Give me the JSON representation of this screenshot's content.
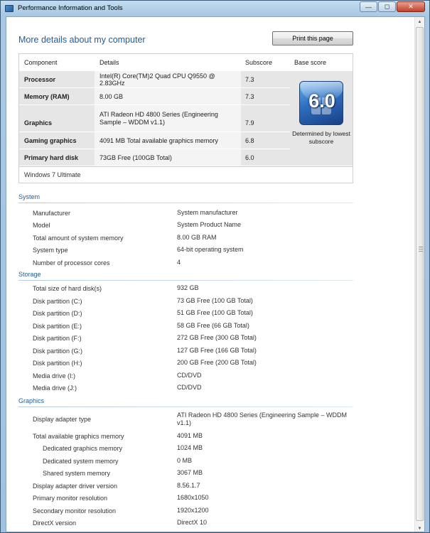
{
  "window": {
    "title": "Performance Information and Tools",
    "controls": {
      "minimize": "—",
      "maximize": "◻",
      "close": "✕"
    }
  },
  "page": {
    "title": "More details about my computer",
    "print_label": "Print this page"
  },
  "scores": {
    "headers": {
      "component": "Component",
      "details": "Details",
      "subscore": "Subscore",
      "base": "Base score"
    },
    "rows": [
      {
        "component": "Processor",
        "details": "Intel(R) Core(TM)2 Quad CPU Q9550 @ 2.83GHz",
        "subscore": "7.3"
      },
      {
        "component": "Memory (RAM)",
        "details": "8.00 GB",
        "subscore": "7.3"
      },
      {
        "component": "Graphics",
        "details": "ATI Radeon HD 4800 Series (Engineering Sample – WDDM v1.1)",
        "subscore": "7.9"
      },
      {
        "component": "Gaming graphics",
        "details": "4091 MB Total available graphics memory",
        "subscore": "6.8"
      },
      {
        "component": "Primary hard disk",
        "details": "73GB Free (100GB Total)",
        "subscore": "6.0"
      }
    ],
    "base_score": "6.0",
    "base_note": "Determined by lowest subscore",
    "edition": "Windows 7 Ultimate"
  },
  "system": {
    "heading": "System",
    "items": [
      {
        "label": "Manufacturer",
        "value": "System manufacturer"
      },
      {
        "label": "Model",
        "value": "System Product Name"
      },
      {
        "label": "Total amount of system memory",
        "value": "8.00 GB RAM"
      },
      {
        "label": "System type",
        "value": "64-bit operating system"
      },
      {
        "label": "Number of processor cores",
        "value": "4"
      }
    ]
  },
  "storage": {
    "heading": "Storage",
    "items": [
      {
        "label": "Total size of hard disk(s)",
        "value": "932 GB"
      },
      {
        "label": "Disk partition (C:)",
        "value": "73 GB Free (100 GB Total)"
      },
      {
        "label": "Disk partition (D:)",
        "value": "51 GB Free (100 GB Total)"
      },
      {
        "label": "Disk partition (E:)",
        "value": "58 GB Free (66 GB Total)"
      },
      {
        "label": "Disk partition (F:)",
        "value": "272 GB Free (300 GB Total)"
      },
      {
        "label": "Disk partition (G:)",
        "value": "127 GB Free (166 GB Total)"
      },
      {
        "label": "Disk partition (H:)",
        "value": "200 GB Free (200 GB Total)"
      },
      {
        "label": "Media drive (I:)",
        "value": "CD/DVD"
      },
      {
        "label": "Media drive (J:)",
        "value": "CD/DVD"
      }
    ]
  },
  "graphics": {
    "heading": "Graphics",
    "items": [
      {
        "label": "Display adapter type",
        "value": "ATI Radeon HD 4800 Series (Engineering Sample – WDDM v1.1)"
      },
      {
        "label": "Total available graphics memory",
        "value": "4091 MB"
      },
      {
        "label": "Dedicated graphics memory",
        "value": "1024 MB"
      },
      {
        "label": "Dedicated system memory",
        "value": "0 MB"
      },
      {
        "label": "Shared system memory",
        "value": "3067 MB"
      },
      {
        "label": "Display adapter driver version",
        "value": "8.56.1.7"
      },
      {
        "label": "Primary monitor resolution",
        "value": "1680x1050"
      },
      {
        "label": "Secondary monitor resolution",
        "value": "1920x1200"
      },
      {
        "label": "DirectX version",
        "value": "DirectX 10"
      }
    ]
  }
}
